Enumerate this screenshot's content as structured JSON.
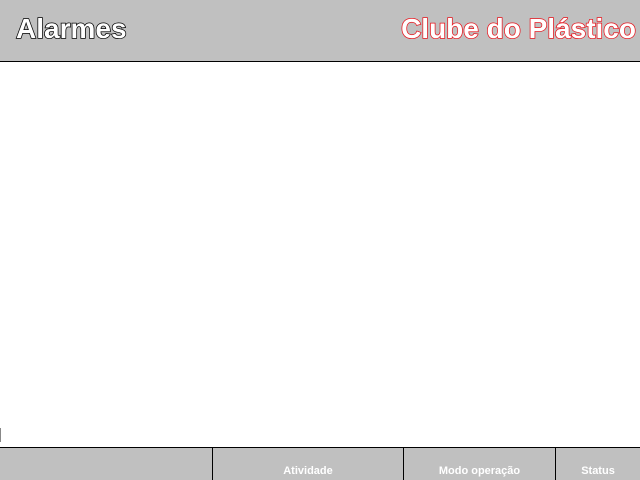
{
  "header": {
    "title": "Alarmes",
    "brand": "Clube do Plástico"
  },
  "footer": {
    "cells": [
      {
        "label": ""
      },
      {
        "label": "Atividade"
      },
      {
        "label": "Modo operação"
      },
      {
        "label": "Status"
      }
    ]
  },
  "colors": {
    "panel_background": "#c0c0c0",
    "brand_outline": "#e8141c",
    "title_outline": "#000000",
    "label_text": "#ffffff"
  }
}
